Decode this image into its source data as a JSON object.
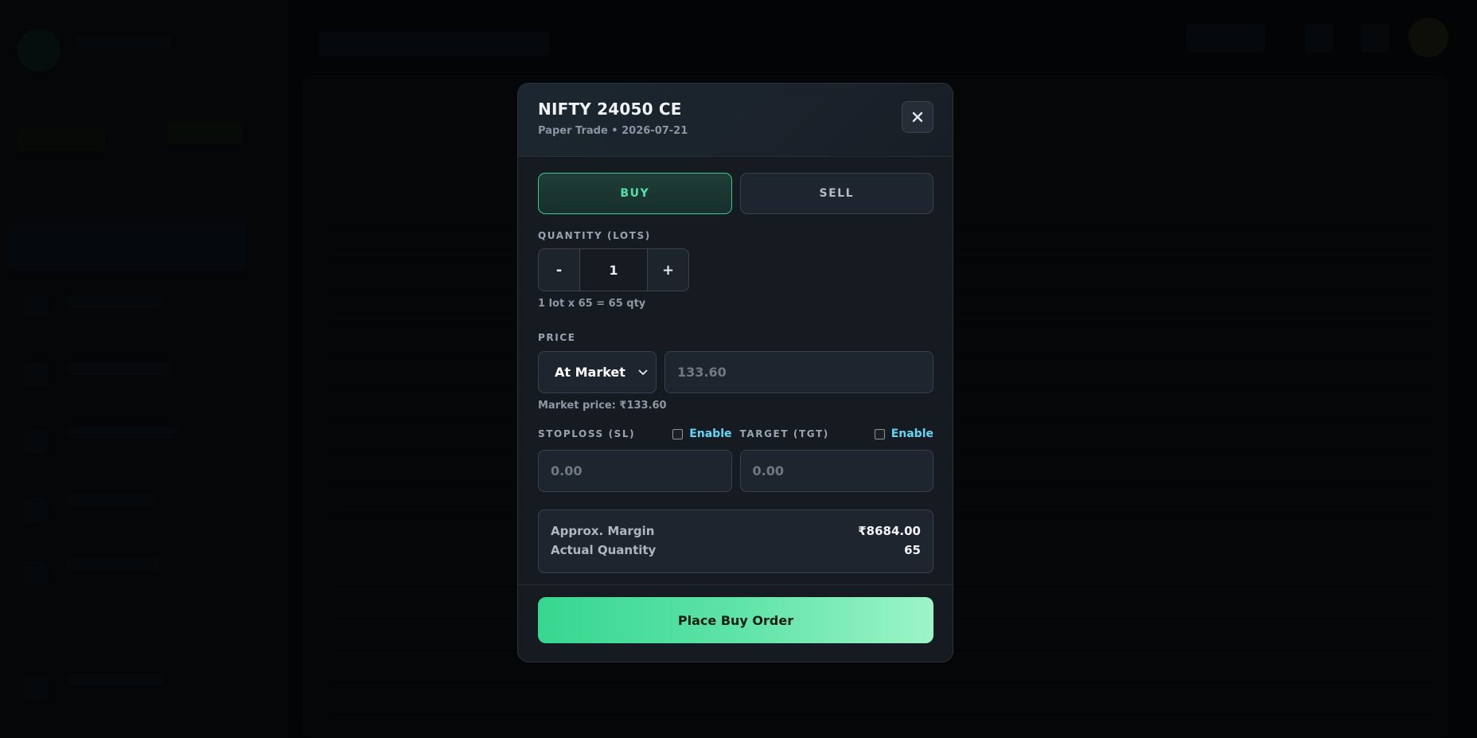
{
  "modal": {
    "title": "NIFTY 24050 CE",
    "subtitle": "Paper Trade • 2026-07-21",
    "close_icon": "close-icon"
  },
  "side": {
    "buy_label": "BUY",
    "sell_label": "SELL",
    "selected": "BUY"
  },
  "quantity": {
    "label": "QUANTITY (LOTS)",
    "decrement_label": "-",
    "value": "1",
    "increment_label": "+",
    "hint": "1 lot x 65 = 65 qty"
  },
  "price": {
    "label": "PRICE",
    "order_type": "At Market",
    "input_placeholder": "133.60",
    "market_hint": "Market price: ₹133.60"
  },
  "stoploss": {
    "label": "STOPLOSS (SL)",
    "enable_label": "Enable",
    "placeholder": "0.00"
  },
  "target": {
    "label": "TARGET (TGT)",
    "enable_label": "Enable",
    "placeholder": "0.00"
  },
  "summary": {
    "margin_label": "Approx. Margin",
    "margin_value": "₹8684.00",
    "qty_label": "Actual Quantity",
    "qty_value": "65"
  },
  "footer": {
    "submit_label": "Place Buy Order"
  },
  "colors": {
    "accent_green": "#37c98c",
    "enable_cyan": "#5fd8f7"
  }
}
